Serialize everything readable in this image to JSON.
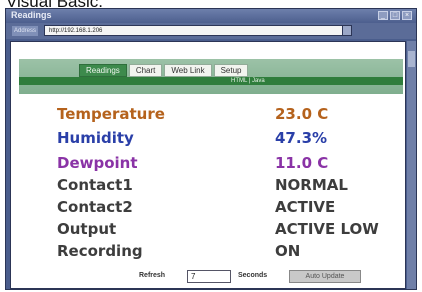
{
  "caption": "Visual Basic.",
  "window": {
    "title": "Readings",
    "address_label": "Address",
    "address": "http://192.168.1.206"
  },
  "tabs": [
    "Readings",
    "Chart",
    "Web Link",
    "Setup"
  ],
  "subbar_text": "HTML | Java",
  "readings": [
    {
      "label": "Temperature",
      "value": "23.0 C",
      "color": "#b5621c"
    },
    {
      "label": "Humidity",
      "value": "47.3%",
      "color": "#2a3fa8"
    },
    {
      "label": "Dewpoint",
      "value": "11.0 C",
      "color": "#8a33a6"
    },
    {
      "label": "Contact1",
      "value": "NORMAL",
      "color": "#3d3d3d"
    },
    {
      "label": "Contact2",
      "value": "ACTIVE",
      "color": "#3d3d3d"
    },
    {
      "label": "Output",
      "value": "ACTIVE LOW",
      "color": "#3d3d3d"
    },
    {
      "label": "Recording",
      "value": "ON",
      "color": "#3d3d3d"
    }
  ],
  "refresh": {
    "label": "Refresh",
    "value": "7",
    "units": "Seconds",
    "button": "Auto Update"
  }
}
